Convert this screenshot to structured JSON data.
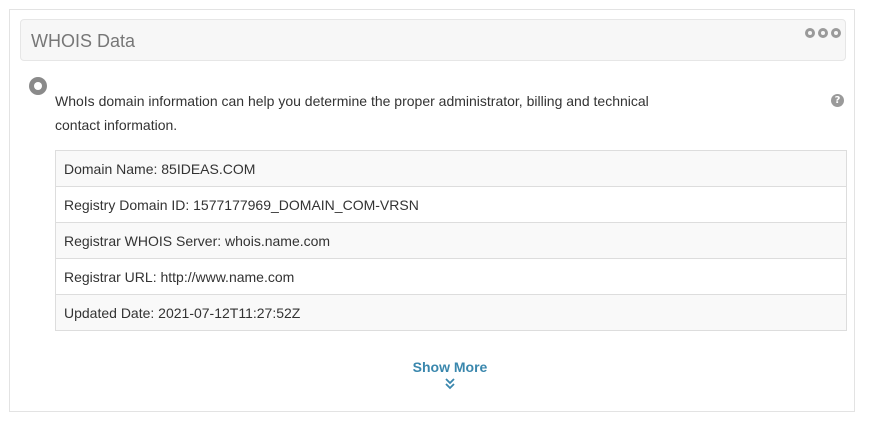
{
  "panel": {
    "title": "WHOIS Data",
    "tools_icon": "gear-icon"
  },
  "info": {
    "text": "WhoIs domain information can help you determine the proper administrator, billing and technical contact information.",
    "help_icon": "question-circle-icon"
  },
  "whois": {
    "rows": [
      "Domain Name: 85IDEAS.COM",
      "Registry Domain ID: 1577177969_DOMAIN_COM-VRSN",
      "Registrar WHOIS Server: whois.name.com",
      "Registrar URL: http://www.name.com",
      "Updated Date: 2021-07-12T11:27:52Z"
    ]
  },
  "footer": {
    "show_more_label": "Show More",
    "show_more_icon": "double-chevron-down-icon"
  },
  "colors": {
    "link": "#3a87ad",
    "header_bg": "#f7f7f7",
    "border": "#dddddd"
  }
}
